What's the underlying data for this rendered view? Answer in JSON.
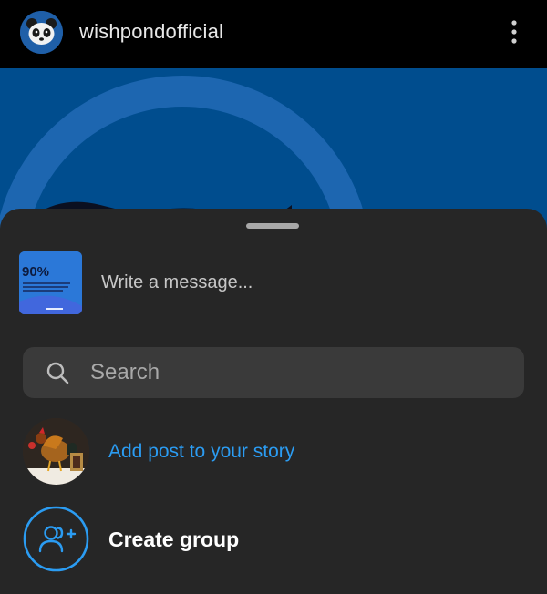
{
  "header": {
    "username": "wishpondofficial",
    "avatar_icon": "panda-icon",
    "more_icon": "more-vertical-icon"
  },
  "post_preview": {
    "background_color": "#004d8e"
  },
  "share_sheet": {
    "thumbnail": {
      "percent_text": "90%"
    },
    "message_placeholder": "Write a message...",
    "search": {
      "placeholder": "Search",
      "icon": "search-icon"
    },
    "add_to_story": {
      "label": "Add post to your story",
      "color": "#2b9cf2"
    },
    "create_group": {
      "label": "Create group",
      "icon": "add-group-icon",
      "accent": "#2b9cf2"
    }
  }
}
